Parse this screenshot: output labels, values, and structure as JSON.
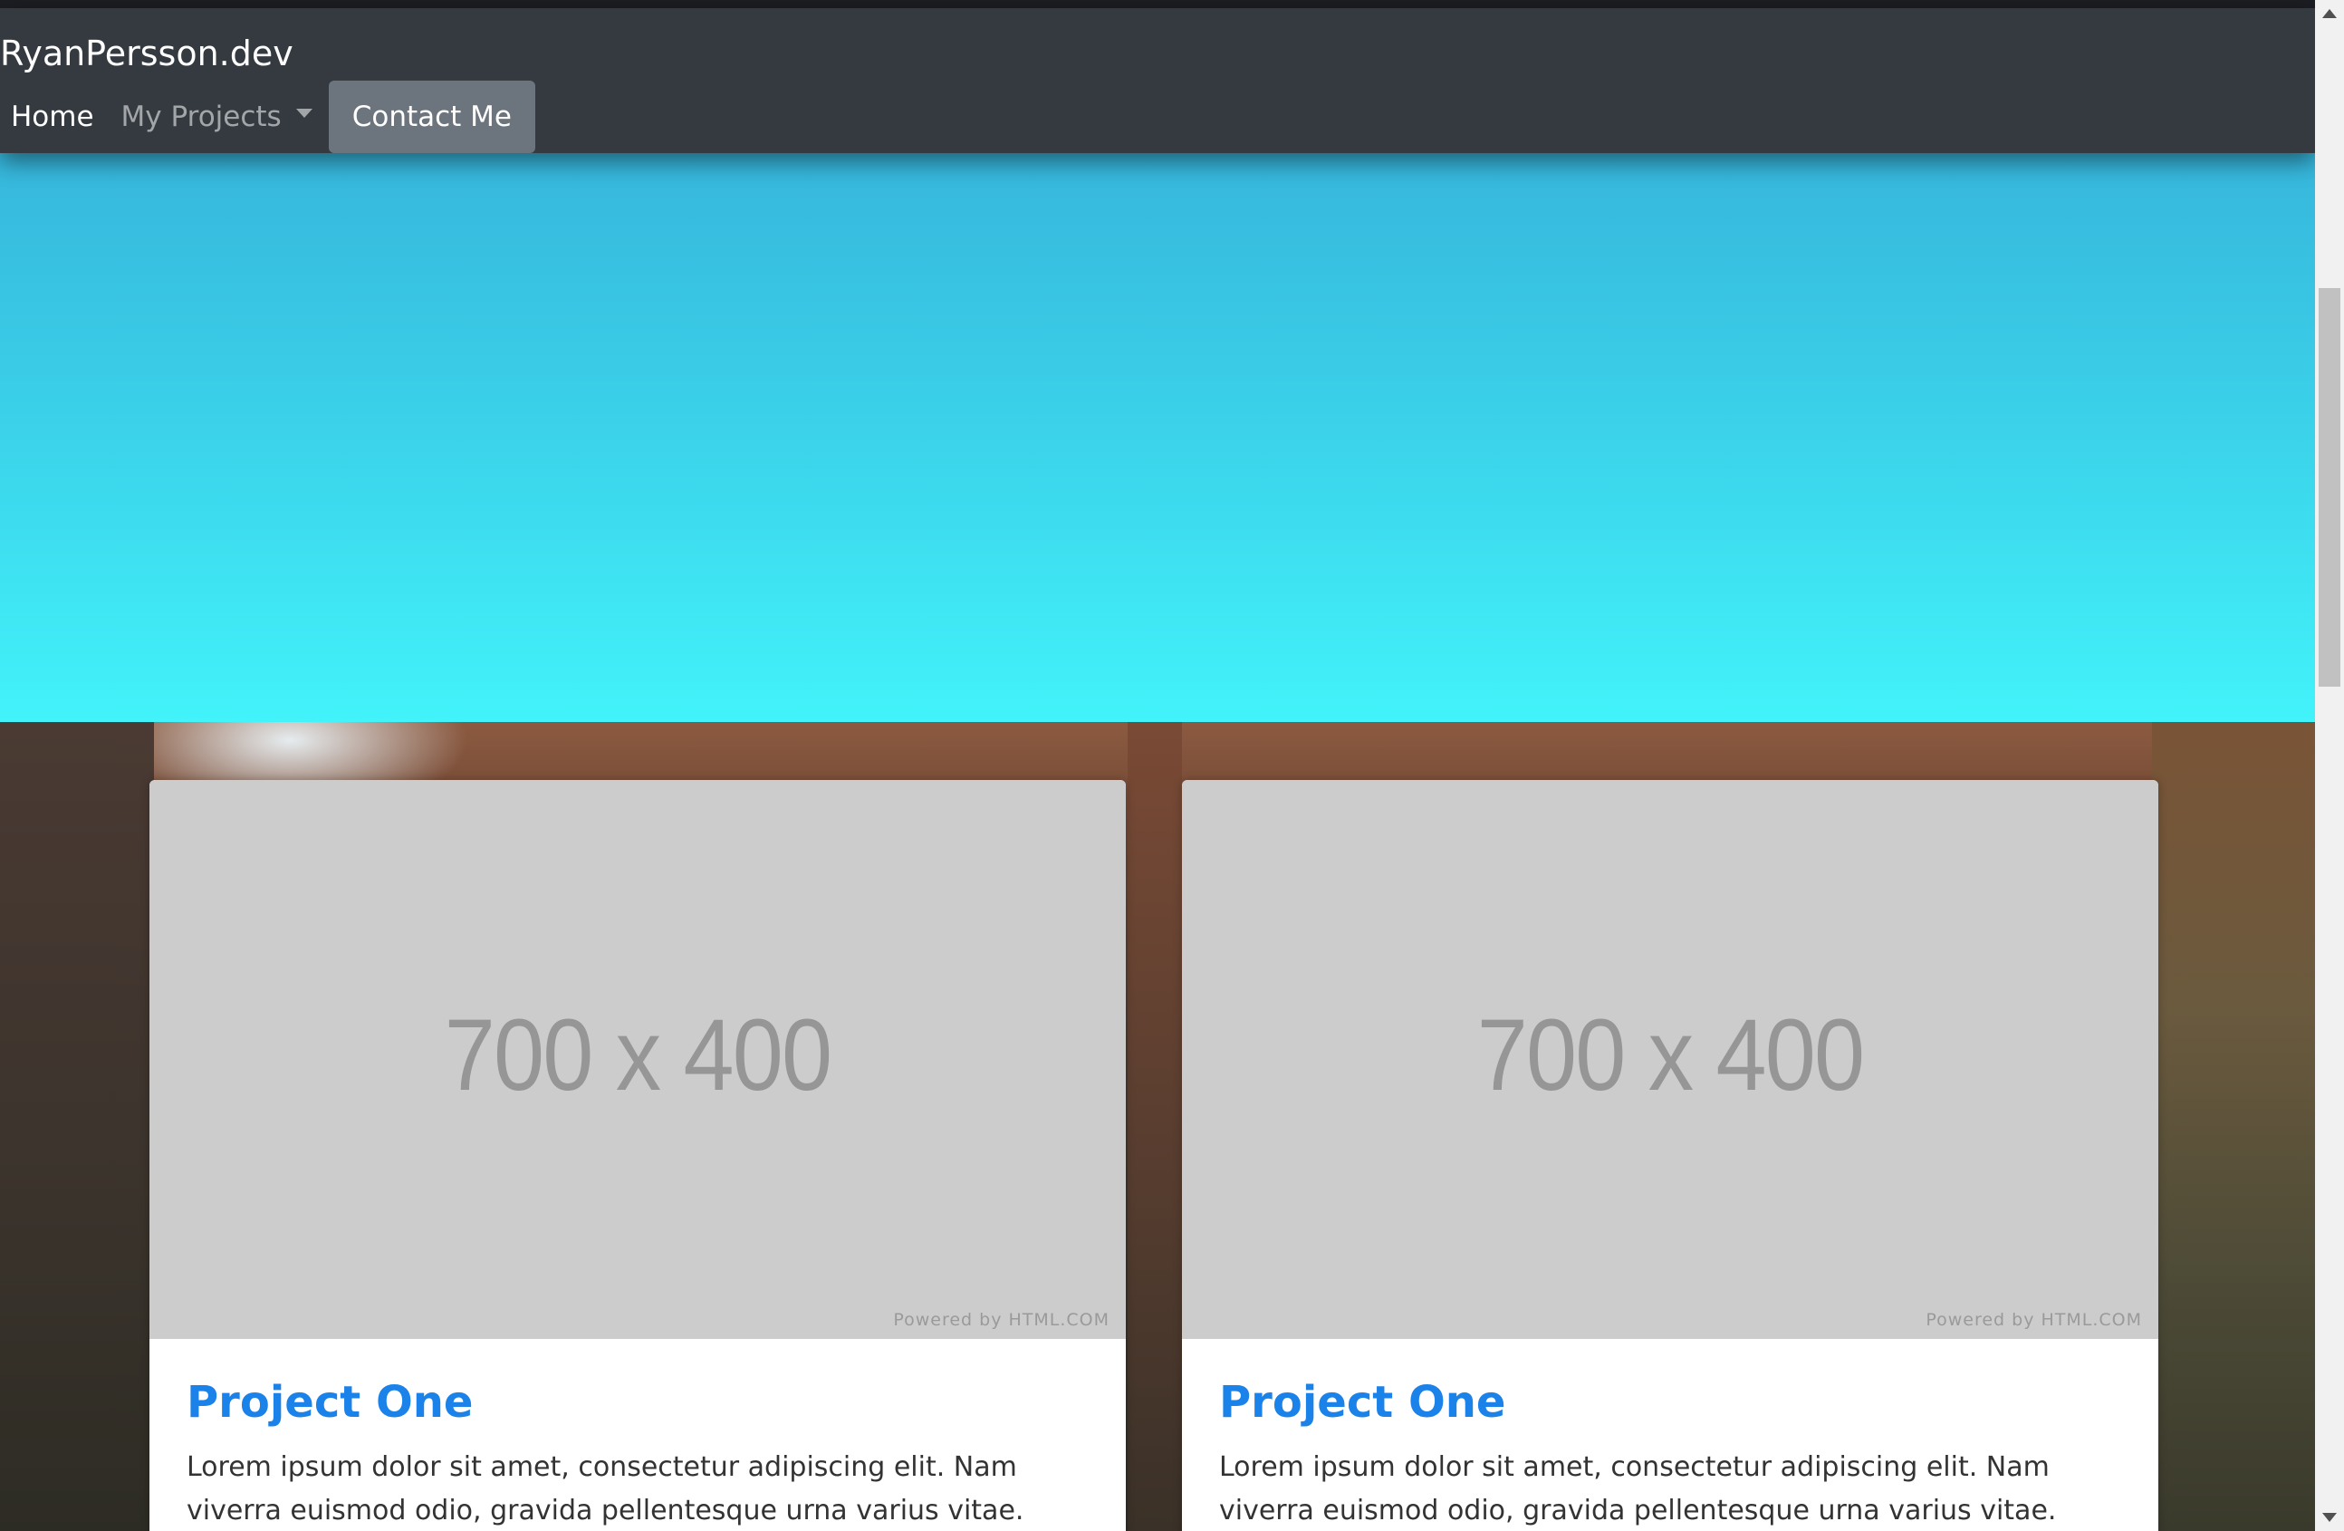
{
  "navbar": {
    "brand": "RyanPersson.dev",
    "links": {
      "home": "Home",
      "projects": "My Projects",
      "contact": "Contact Me"
    }
  },
  "cards": [
    {
      "placeholder": "700 x 400",
      "powered_by": "Powered by HTML.COM",
      "title": "Project One",
      "text": "Lorem ipsum dolor sit amet, consectetur adipiscing elit. Nam viverra euismod odio, gravida pellentesque urna varius vitae."
    },
    {
      "placeholder": "700 x 400",
      "powered_by": "Powered by HTML.COM",
      "title": "Project One",
      "text": "Lorem ipsum dolor sit amet, consectetur adipiscing elit. Nam viverra euismod odio, gravida pellentesque urna varius vitae."
    }
  ],
  "colors": {
    "navbar_bg": "#343a40",
    "contact_button_bg": "#6c757d",
    "hero_top": "#36b6dc",
    "hero_bottom": "#42f3fa",
    "card_title": "#1a82e8",
    "placeholder_bg": "#cccccc"
  },
  "icons": {
    "dropdown": "caret-down-icon",
    "scroll_up": "scroll-up-arrow-icon",
    "scroll_down": "scroll-down-arrow-icon"
  }
}
